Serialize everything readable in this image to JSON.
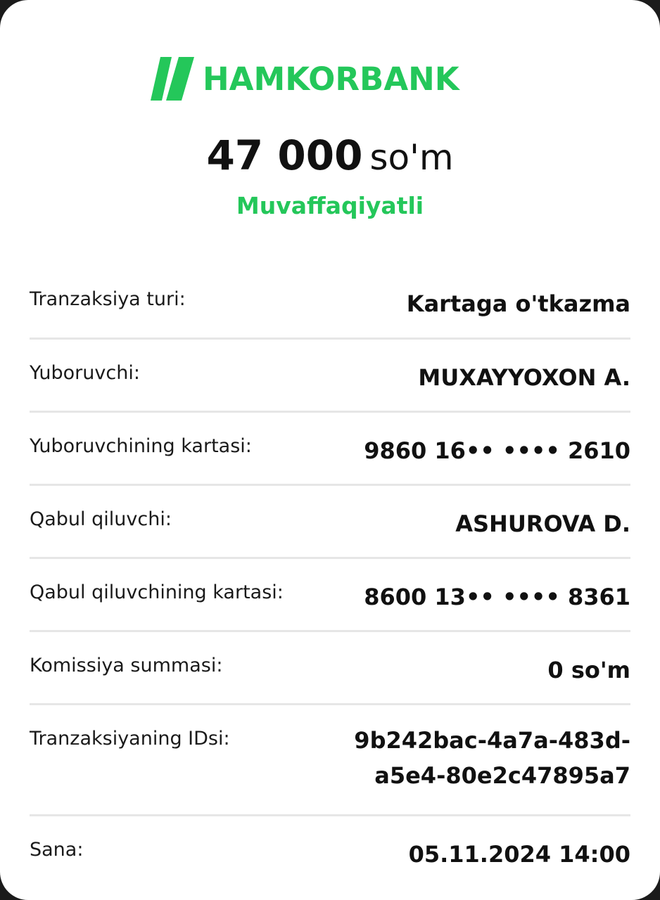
{
  "brand": {
    "name": "HAMKORBANK",
    "color": "#24c75a"
  },
  "amount": {
    "value": "47 000",
    "currency": "so'm"
  },
  "status": "Muvaffaqiyatli",
  "details": [
    {
      "label": "Tranzaksiya turi:",
      "value": "Kartaga o'tkazma"
    },
    {
      "label": "Yuboruvchi:",
      "value": "MUXAYYOXON A."
    },
    {
      "label": "Yuboruvchining kartasi:",
      "value": "9860 16•• •••• 2610"
    },
    {
      "label": "Qabul qiluvchi:",
      "value": "ASHUROVA D."
    },
    {
      "label": "Qabul qiluvchining kartasi:",
      "value": "8600 13•• •••• 8361"
    },
    {
      "label": "Komissiya summasi:",
      "value": "0 so'm"
    },
    {
      "label": "Tranzaksiyaning IDsi:",
      "value_line1": "9b242bac-4a7a-483d-",
      "value_line2": "a5e4-80e2c47895a7"
    },
    {
      "label": "Sana:",
      "value": "05.11.2024 14:00"
    }
  ]
}
